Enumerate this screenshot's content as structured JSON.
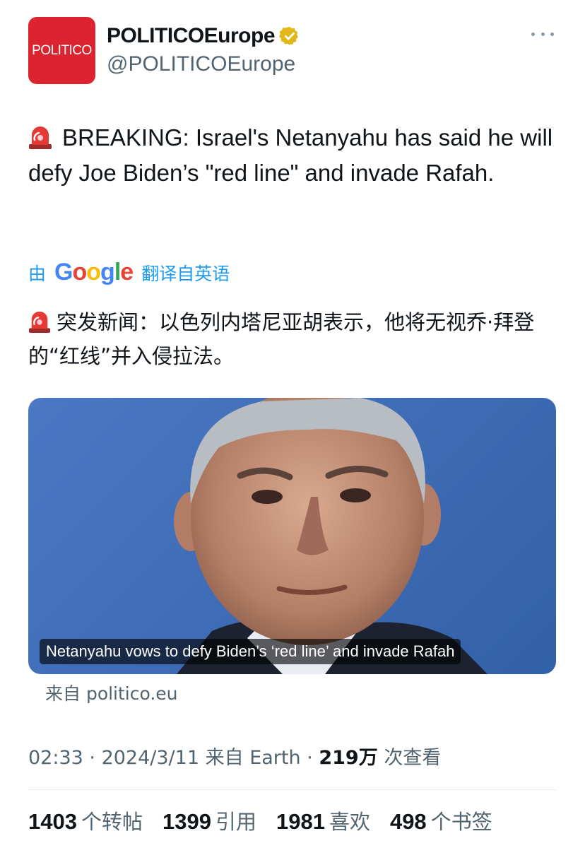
{
  "account": {
    "avatar_text": "POLITICO",
    "display_name": "POLITICOEurope",
    "handle": "@POLITICOEurope",
    "verified_icon": "verified-badge-gold"
  },
  "tweet": {
    "emoji": "rotating-light-icon",
    "text": "BREAKING: Israel's Netanyahu has said he will defy Joe Biden’s \"red line\" and invade Rafah."
  },
  "translation": {
    "prefix": "由",
    "provider_letters": [
      "G",
      "o",
      "o",
      "g",
      "l",
      "e"
    ],
    "suffix": "翻译自英语",
    "text": "突发新闻：以色列内塔尼亚胡表示，他将无视乔·拜登的“红线”并入侵拉法。"
  },
  "card": {
    "caption": "Netanyahu vows to defy Biden’s ‘red line’ and invade Rafah",
    "source": "来自 politico.eu"
  },
  "meta": {
    "time": "02:33",
    "date": "2024/3/11",
    "client": "来自 Earth",
    "views_value": "219万",
    "views_label": "次查看"
  },
  "stats": {
    "reposts_value": "1403",
    "reposts_label": "个转帖",
    "quotes_value": "1399",
    "quotes_label": "引用",
    "likes_value": "1981",
    "likes_label": "喜欢",
    "bookmarks_value": "498",
    "bookmarks_label": "个书签"
  },
  "colors": {
    "brand_red": "#dc2430",
    "link_blue": "#1d9bf0",
    "secondary_text": "#536471",
    "verified_gold": "#e2b719"
  }
}
